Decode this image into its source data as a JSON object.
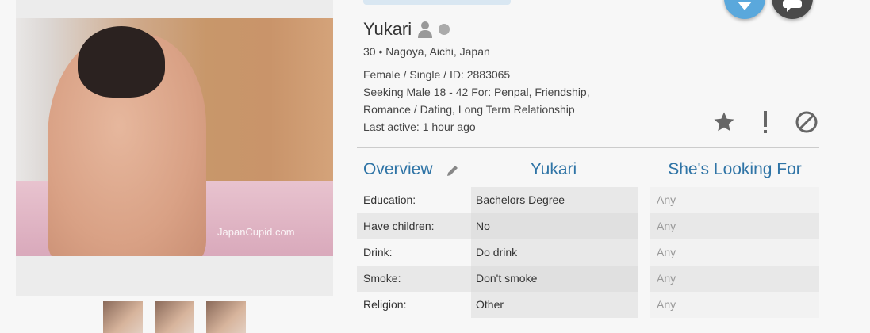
{
  "profile": {
    "name": "Yukari",
    "location": "30 • Nagoya, Aichi, Japan",
    "details_line1": "Female / Single / ID: 2883065",
    "details_line2": "Seeking Male 18 - 42 For: Penpal, Friendship,",
    "details_line3": "Romance / Dating, Long Term Relationship",
    "last_active": "Last active: 1 hour ago",
    "photo_watermark": "JapanCupid.com"
  },
  "icons": {
    "favorite": "star-icon",
    "report": "exclamation-icon",
    "block": "block-icon",
    "like": "heart-icon",
    "chat": "chat-icon",
    "edit": "pencil-icon",
    "user": "user-icon"
  },
  "colors": {
    "accent": "#2f74a6",
    "like": "#5aa8dc",
    "chat": "#4a4a4a"
  },
  "overview": {
    "overview_label": "Overview",
    "her_label": "Yukari",
    "looking_label": "She's Looking For",
    "rows": [
      {
        "label": "Education:",
        "value": "Bachelors Degree",
        "want": "Any"
      },
      {
        "label": "Have children:",
        "value": "No",
        "want": "Any"
      },
      {
        "label": "Drink:",
        "value": "Do drink",
        "want": "Any"
      },
      {
        "label": "Smoke:",
        "value": "Don't smoke",
        "want": "Any"
      },
      {
        "label": "Religion:",
        "value": "Other",
        "want": "Any"
      }
    ]
  }
}
